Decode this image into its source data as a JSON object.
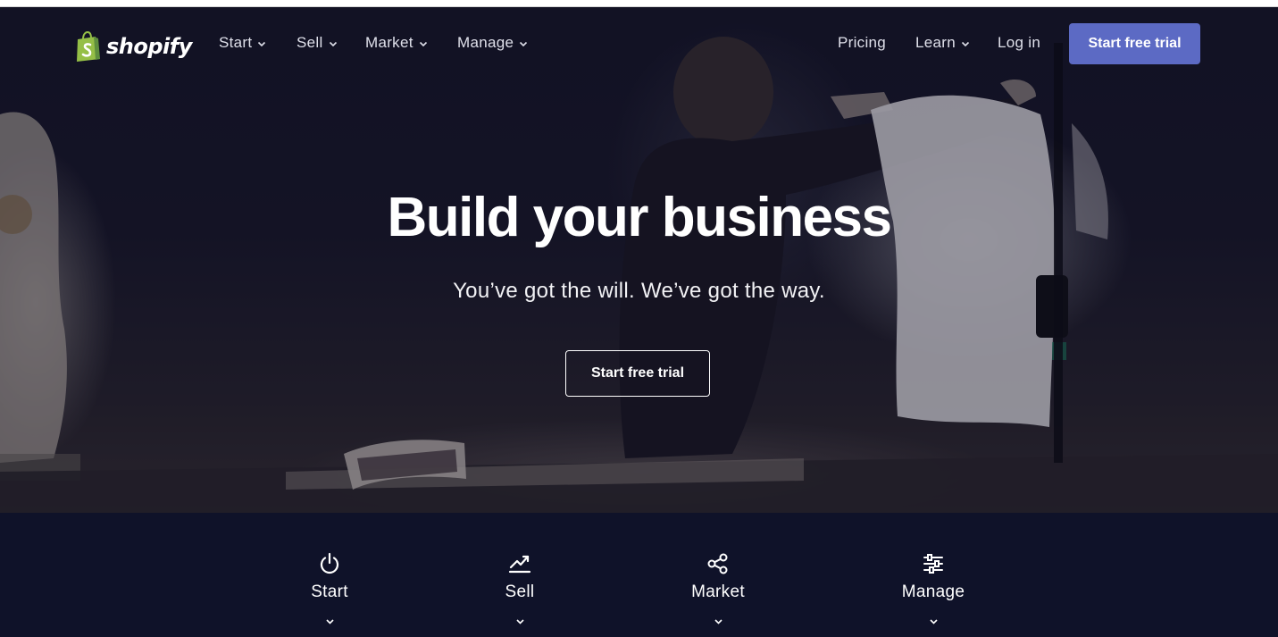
{
  "brand": {
    "name": "shopify",
    "green": "#95bf47",
    "green_dark": "#5e8e3e",
    "accent": "#5c6ac4",
    "footer_bg": "#0f1229"
  },
  "nav": {
    "left_items": [
      {
        "label": "Start",
        "icon": "chevron-down-icon"
      },
      {
        "label": "Sell",
        "icon": "chevron-down-icon"
      },
      {
        "label": "Market",
        "icon": "chevron-down-icon"
      },
      {
        "label": "Manage",
        "icon": "chevron-down-icon"
      }
    ],
    "pricing": "Pricing",
    "learn": {
      "label": "Learn",
      "icon": "chevron-down-icon"
    },
    "login": "Log in",
    "cta": "Start free trial"
  },
  "hero": {
    "title": "Build your business",
    "subtitle": "You’ve got the will. We’ve got the way.",
    "cta": "Start free trial"
  },
  "features": [
    {
      "label": "Start",
      "icon": "power-icon"
    },
    {
      "label": "Sell",
      "icon": "trending-up-chart-icon"
    },
    {
      "label": "Market",
      "icon": "share-icon"
    },
    {
      "label": "Manage",
      "icon": "sliders-icon"
    }
  ]
}
